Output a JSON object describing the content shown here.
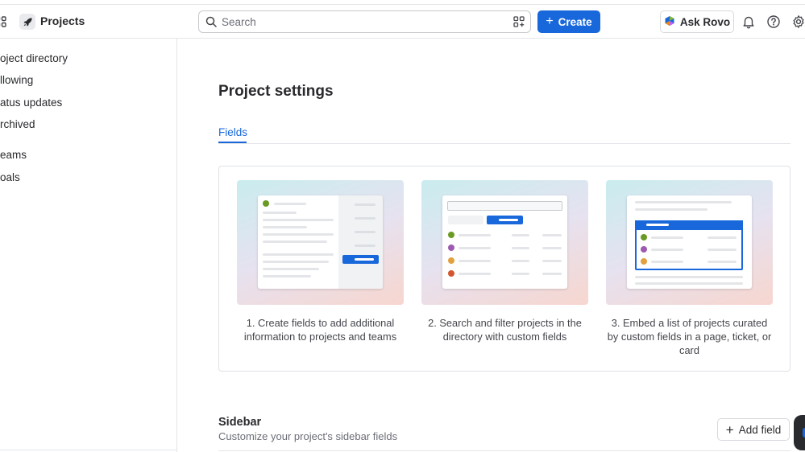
{
  "header": {
    "project_title": "Projects",
    "search_placeholder": "Search",
    "create_label": "Create",
    "rovo_label": "Ask Rovo"
  },
  "sidebar": {
    "items": [
      {
        "label": "oject directory"
      },
      {
        "label": "llowing"
      },
      {
        "label": "atus updates"
      },
      {
        "label": "rchived"
      },
      {
        "label": "eams"
      },
      {
        "label": "oals"
      }
    ]
  },
  "main": {
    "page_title": "Project settings",
    "tabs": [
      {
        "label": "Fields"
      }
    ],
    "cards": [
      {
        "caption": "1. Create fields to add additional information to projects and teams"
      },
      {
        "caption": "2. Search and filter projects in the directory with custom fields"
      },
      {
        "caption": "3. Embed a list of projects curated by custom fields in a page, ticket, or card"
      }
    ],
    "section": {
      "title": "Sidebar",
      "subtitle": "Customize your project's sidebar fields",
      "add_label": "Add field"
    }
  },
  "colors": {
    "accent": "#1868db",
    "text": "#292a2e",
    "subtle": "#6b6e76",
    "border": "#e4e5e8"
  },
  "icons": [
    "app-switcher-icon",
    "rocket-icon",
    "search-icon",
    "filter-icon",
    "plus-icon",
    "rovo-icon",
    "bell-icon",
    "help-icon",
    "settings-icon"
  ]
}
